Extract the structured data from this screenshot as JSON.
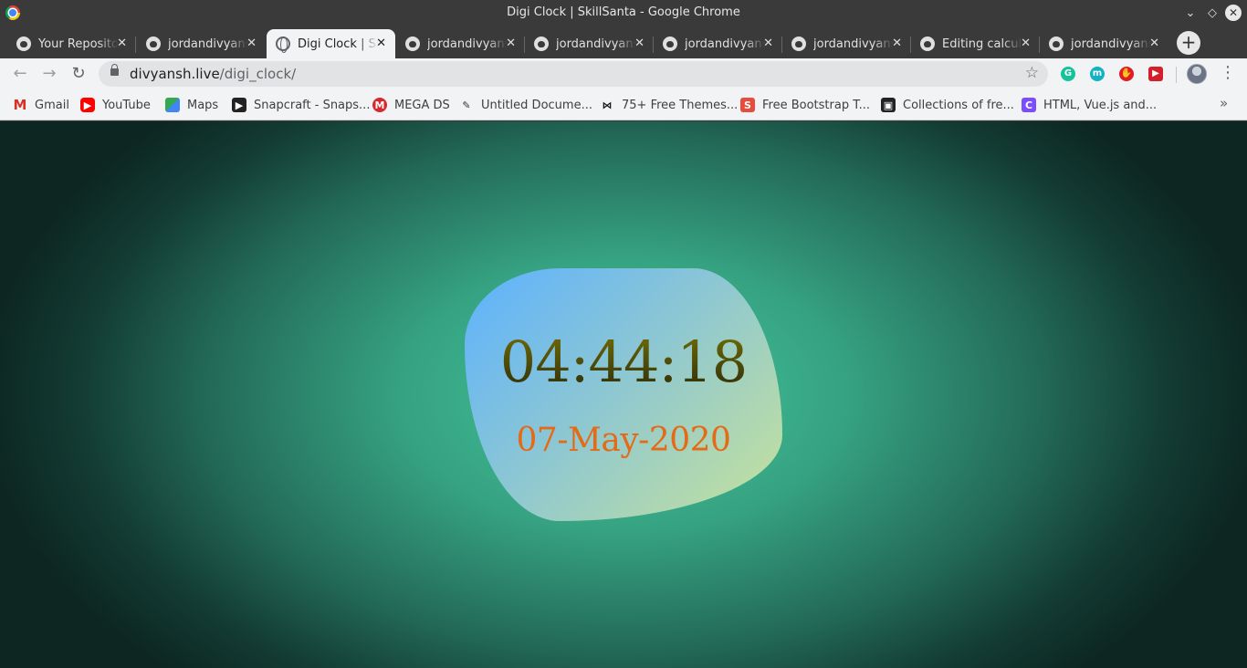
{
  "window": {
    "title": "Digi Clock | SkillSanta - Google Chrome",
    "min_glyph": "⌄",
    "max_glyph": "◇",
    "close_glyph": "✕"
  },
  "tabs": [
    {
      "label": "Your Repositories",
      "icon": "github-icon",
      "active": false
    },
    {
      "label": "jordandivyansh",
      "icon": "github-icon",
      "active": false
    },
    {
      "label": "Digi Clock | SkillSanta",
      "icon": "globe-icon",
      "active": true
    },
    {
      "label": "jordandivyansh",
      "icon": "github-icon",
      "active": false
    },
    {
      "label": "jordandivyansh",
      "icon": "github-icon",
      "active": false
    },
    {
      "label": "jordandivyansh",
      "icon": "github-icon",
      "active": false
    },
    {
      "label": "jordandivyansh",
      "icon": "github-icon",
      "active": false
    },
    {
      "label": "Editing calculator",
      "icon": "github-icon",
      "active": false
    },
    {
      "label": "jordandivyansh",
      "icon": "github-icon",
      "active": false
    }
  ],
  "tab_close_glyph": "✕",
  "new_tab_glyph": "+",
  "toolbar": {
    "back_glyph": "←",
    "forward_glyph": "→",
    "reload_glyph": "↻",
    "url_host": "divyansh.live",
    "url_path": "/digi_clock/",
    "star_glyph": "☆",
    "menu_glyph": "⋮",
    "extensions": [
      {
        "name": "grammarly-extension-icon",
        "glyph": "G"
      },
      {
        "name": "m-extension-icon",
        "glyph": "m"
      },
      {
        "name": "adblock-extension-icon",
        "glyph": "✋"
      },
      {
        "name": "stream-extension-icon",
        "glyph": "▶"
      }
    ]
  },
  "bookmarks": [
    {
      "label": "Gmail",
      "icon": "gmail-icon",
      "glyph": "M"
    },
    {
      "label": "YouTube",
      "icon": "youtube-icon",
      "glyph": "▶"
    },
    {
      "label": "Maps",
      "icon": "maps-icon",
      "glyph": ""
    },
    {
      "label": "Snapcraft - Snaps...",
      "icon": "snapcraft-icon",
      "glyph": "▶"
    },
    {
      "label": "MEGA DS",
      "icon": "mega-icon",
      "glyph": "M"
    },
    {
      "label": "Untitled Docume...",
      "icon": "document-icon",
      "glyph": "✎"
    },
    {
      "label": "75+ Free Themes...",
      "icon": "mask-icon",
      "glyph": "⋈"
    },
    {
      "label": "Free Bootstrap T...",
      "icon": "bootstrap-s-icon",
      "glyph": "S"
    },
    {
      "label": "Collections of fre...",
      "icon": "collections-icon",
      "glyph": "▣"
    },
    {
      "label": "HTML, Vue.js and...",
      "icon": "c-icon",
      "glyph": "C"
    }
  ],
  "bookmarks_more_glyph": "»",
  "clock": {
    "time": "04:44:18",
    "date": "07-May-2020"
  },
  "colors": {
    "background_center": "#42c59b",
    "background_edge": "#0d2622",
    "blob_start": "#5cb1ff",
    "blob_end": "#c7e29a",
    "time_color": "#4a4a08",
    "date_color": "#e36a17"
  }
}
